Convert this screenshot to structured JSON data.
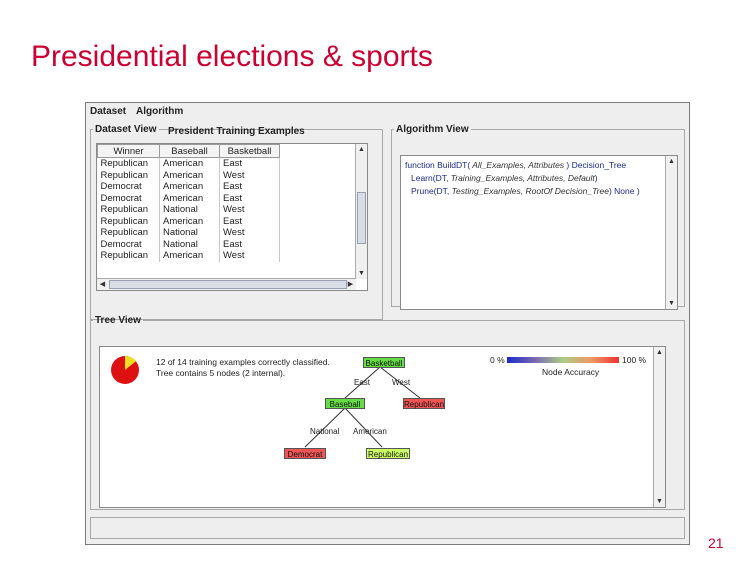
{
  "slide": {
    "title": "Presidential elections & sports",
    "page_number": "21"
  },
  "menu": {
    "items": [
      "Dataset",
      "Algorithm"
    ]
  },
  "dataset_view": {
    "legend": "Dataset View",
    "caption": "President  Training Examples",
    "columns": [
      "Winner",
      "Baseball",
      "Basketball"
    ],
    "rows": [
      [
        "Republican",
        "American",
        "East"
      ],
      [
        "Republican",
        "American",
        "West"
      ],
      [
        "Democrat",
        "American",
        "East"
      ],
      [
        "Democrat",
        "American",
        "East"
      ],
      [
        "Republican",
        "National",
        "West"
      ],
      [
        "Republican",
        "American",
        "East"
      ],
      [
        "Republican",
        "National",
        "West"
      ],
      [
        "Democrat",
        "National",
        "East"
      ],
      [
        "Republican",
        "American",
        "West"
      ]
    ]
  },
  "algorithm_view": {
    "legend": "Algorithm View",
    "lines": [
      {
        "kw": "function BuildDT(",
        "args": " All_Examples, Attributes ",
        "rest": ") Decision_Tree"
      },
      {
        "kw": "Learn(DT, ",
        "args": "Training_Examples, Attributes, Default",
        "rest": ")"
      },
      {
        "kw": "Prune(DT, ",
        "args": "Testing_Examples, RootOf Decision_Tree",
        "rest": ") None )"
      }
    ]
  },
  "tree_view": {
    "legend": "Tree View",
    "stats": [
      "12 of 14 training examples correctly classified.",
      "Tree contains 5 nodes (2 internal)."
    ],
    "accuracy_fraction": 0.857,
    "legend_min": "0 %",
    "legend_max": "100 %",
    "legend_label": "Node Accuracy",
    "nodes": {
      "root": "Basketball",
      "baseball": "Baseball",
      "rep_west": "Republican",
      "dem": "Democrat",
      "rep_american": "Republican"
    },
    "edges": {
      "east": "East",
      "west": "West",
      "national": "National",
      "american": "American"
    },
    "colors": {
      "green_node": "#66dd44",
      "red_node": "#ee5555",
      "lime_node": "#ccff66",
      "pie_red": "#dd1111",
      "pie_yellow": "#eedd22"
    }
  }
}
